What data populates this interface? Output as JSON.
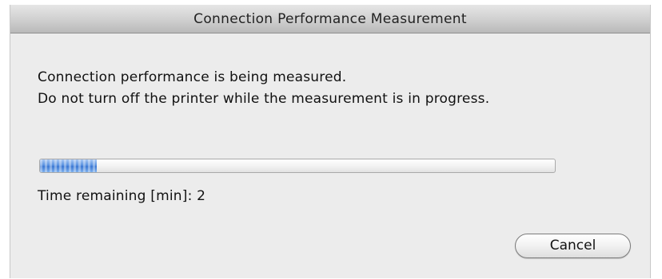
{
  "dialog": {
    "title": "Connection Performance Measurement",
    "message_line1": "Connection performance is being measured.",
    "message_line2": "Do not turn off the printer while the measurement is in progress.",
    "progress_fraction": 0.11,
    "time_remaining_text": "Time remaining [min]: 2",
    "cancel_label": "Cancel"
  },
  "colors": {
    "progress_blue": "#3c78d3",
    "window_background": "#ececec"
  }
}
